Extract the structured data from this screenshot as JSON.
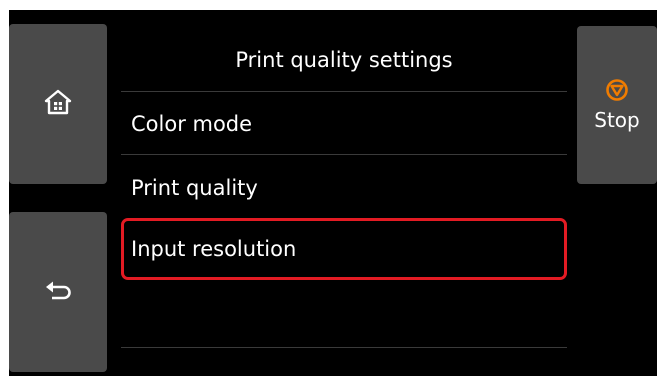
{
  "header": {
    "title": "Print quality settings"
  },
  "nav": {
    "home_icon": "home-icon",
    "back_icon": "back-arrow-icon",
    "stop_icon": "stop-icon",
    "stop_label": "Stop"
  },
  "menu": {
    "items": [
      {
        "label": "Color mode",
        "selected": false
      },
      {
        "label": "Print quality",
        "selected": false
      },
      {
        "label": "Input resolution",
        "selected": true
      }
    ]
  },
  "colors": {
    "background": "#000000",
    "button": "#4a4a4a",
    "selection_border": "#e31b23",
    "stop_accent": "#f07c00",
    "text": "#ffffff"
  }
}
